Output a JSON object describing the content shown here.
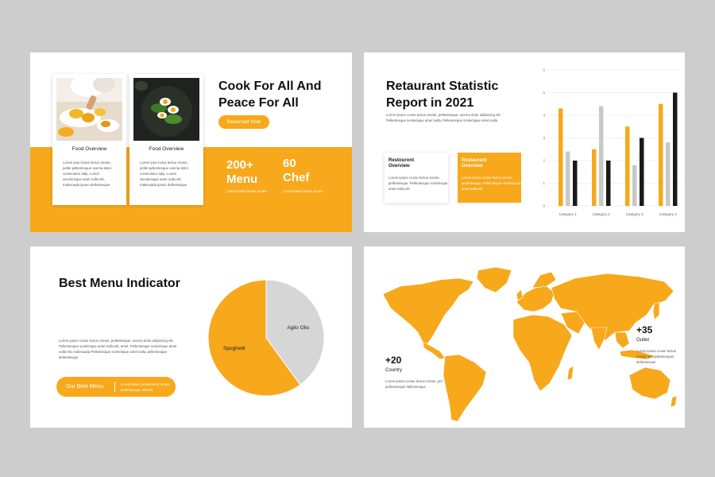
{
  "slide1": {
    "title": "Cook For All And Peace For All",
    "button": "Reserved Now",
    "cards": [
      {
        "name": "Food Overview",
        "desc": "Lorem ipsu loctus lectus ornare, peller pellentesque uverna dolor consectetur adip. Lorem sscelerisque amet nulla elit, malesuada ipsum dellentesque"
      },
      {
        "name": "Food Overview",
        "desc": "Lorem ipsu loctus lectus ornare, peller pellentesque uverna dolor consectetur adip. Lorem sscelerisque amet nulla elit, malesuada ipsum dellentesque"
      }
    ],
    "stats": [
      {
        "value": "200+",
        "label": "Menu",
        "desc": "Lorem ipsum loctus ornare"
      },
      {
        "value": "60",
        "label": "Chef",
        "desc": "Lorem ipsum loctus ornare"
      }
    ]
  },
  "slide2": {
    "title": "Retaurant Statistic Report in 2021",
    "desc": "Lorem ipsum conse lectus ornare, pellentesque, uverna dolor adipiscing elit. Pellentesque scelerisque amet nulla, Pellentesque scelerisque amet nulla",
    "boxes": [
      {
        "heading": "Restouront Overview",
        "desc": "Lorem ipsum conse lectus ornare, pellentesque. Pellentesque scelerisque amet nulla elit"
      },
      {
        "heading": "Restaurant Overview",
        "desc": "Lorem ipsum conse lectus ornare, pellentesque. Pellentesque scelerisque amet nulla elit"
      }
    ]
  },
  "chart_data": {
    "type": "bar",
    "categories": [
      "Category 1",
      "Category 2",
      "Category 3",
      "Category 4"
    ],
    "series": [
      {
        "values": [
          4.3,
          2.5,
          3.5,
          4.5
        ],
        "color": "#f7a81b"
      },
      {
        "values": [
          2.4,
          4.4,
          1.8,
          2.8
        ],
        "color": "#c8c8c8"
      },
      {
        "values": [
          2.0,
          2.0,
          3.0,
          5.0
        ],
        "color": "#1a1a1a"
      }
    ],
    "yticks": [
      "0",
      "1",
      "2",
      "3",
      "4",
      "5",
      "6"
    ],
    "ylim": [
      0,
      6
    ],
    "grid": true
  },
  "slide3": {
    "title": "Best Menu Indicator",
    "desc": "Lorem ipsum conse lectus ornare, pellentesque, uverna dolor adipiscing elit. Pellentesque scelerisque amet nulla elit, amet. Pellentesque scelerisque amet nulla elit, malesuada Pellentesque scelerisque amet nulla, pellentesque dellentesque",
    "button": "Our Best Menu",
    "button_desc": "Lorem ipsum consectetur ornare, pellentesque, elitvelit",
    "pie": [
      {
        "label": "Spoghetti",
        "value": 60,
        "color": "#f7a81b"
      },
      {
        "label": "Aglio Olio",
        "value": 40,
        "color": "#d6d6d6"
      }
    ]
  },
  "slide4": {
    "stats": [
      {
        "value": "+20",
        "label": "Country",
        "desc": "Lorem ipsum conse lectus ornare, pel pellentesquel dellentesque"
      },
      {
        "value": "+35",
        "label": "Outlet",
        "desc": "Lorem ipsum conse lectus ornare, pel pellentesquel dellentesque"
      }
    ]
  },
  "colors": {
    "accent": "#f7a81b",
    "background": "#cdcdcd",
    "grey_bar": "#c8c8c8",
    "dark_bar": "#1a1a1a"
  }
}
